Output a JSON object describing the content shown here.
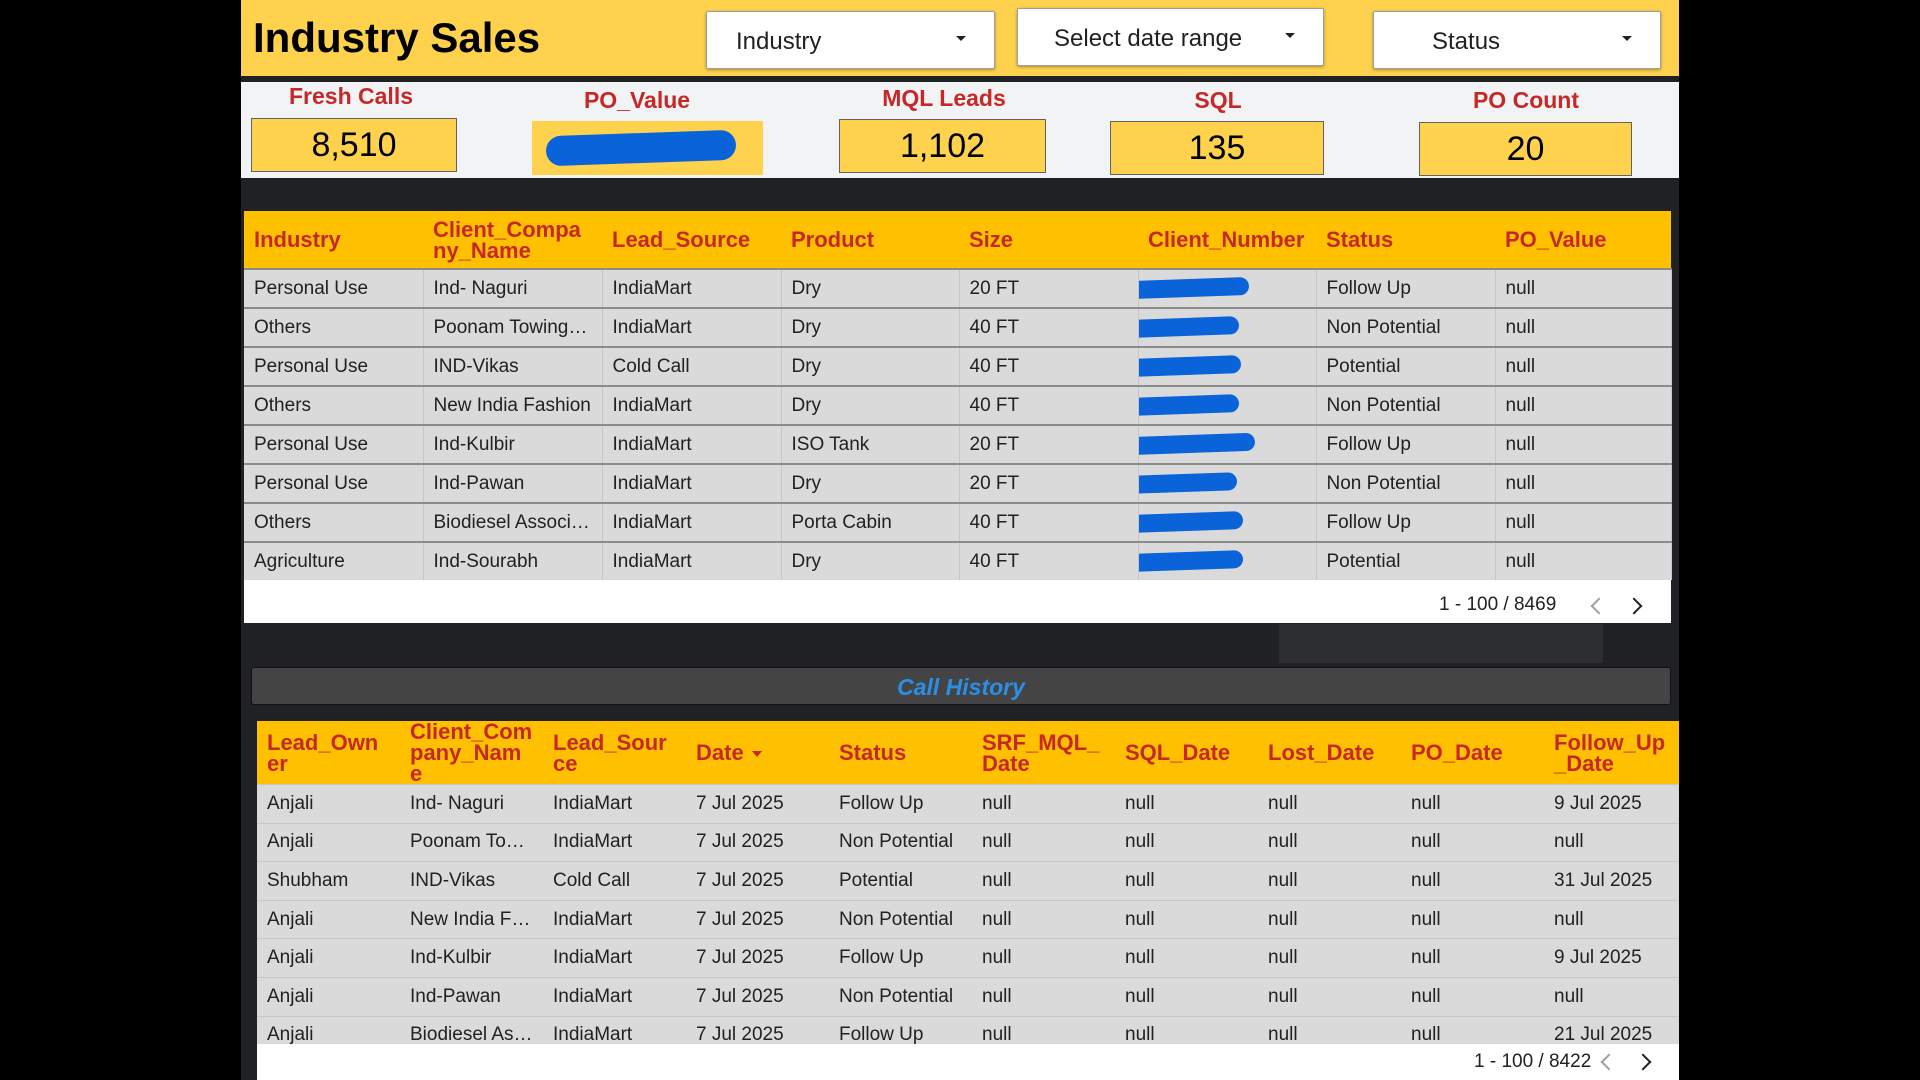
{
  "header": {
    "title": "Industry Sales",
    "filters": [
      {
        "label": "Industry"
      },
      {
        "label": "Select date range"
      },
      {
        "label": "Status"
      }
    ]
  },
  "kpis": [
    {
      "title": "Fresh Calls",
      "value": "8,510"
    },
    {
      "title": "PO_Value",
      "value": ""
    },
    {
      "title": "MQL Leads",
      "value": "1,102"
    },
    {
      "title": "SQL",
      "value": "135"
    },
    {
      "title": "PO Count",
      "value": "20"
    }
  ],
  "colors": {
    "header_bg": "#FFD24D",
    "table_header_bg": "#FFC000",
    "header_text": "#C62828",
    "redaction": "#0A63D8",
    "call_history_title": "#2B8FE8"
  },
  "leads_table": {
    "columns": [
      "Industry",
      "Client_Company_Name",
      "Lead_Source",
      "Product",
      "Size",
      "Client_Number",
      "Status",
      "PO_Value"
    ],
    "rows": [
      [
        "Personal Use",
        "Ind- Naguri",
        "IndiaMart",
        "Dry",
        "20 FT",
        "",
        "Follow Up",
        "null"
      ],
      [
        "Others",
        "Poonam Towing Service",
        "IndiaMart",
        "Dry",
        "40 FT",
        "",
        "Non Potential",
        "null"
      ],
      [
        "Personal Use",
        "IND-Vikas",
        "Cold Call",
        "Dry",
        "40 FT",
        "",
        "Potential",
        "null"
      ],
      [
        "Others",
        "New India Fashion",
        "IndiaMart",
        "Dry",
        "40 FT",
        "",
        "Non Potential",
        "null"
      ],
      [
        "Personal Use",
        "Ind-Kulbir",
        "IndiaMart",
        "ISO Tank",
        "20 FT",
        "",
        "Follow Up",
        "null"
      ],
      [
        "Personal Use",
        "Ind-Pawan",
        "IndiaMart",
        "Dry",
        "20 FT",
        "",
        "Non Potential",
        "null"
      ],
      [
        "Others",
        "Biodiesel Association",
        "IndiaMart",
        "Porta Cabin",
        "40 FT",
        "",
        "Follow Up",
        "null"
      ],
      [
        "Agriculture",
        "Ind-Sourabh",
        "IndiaMart",
        "Dry",
        "40 FT",
        "",
        "Potential",
        "null"
      ]
    ],
    "pagination": "1 - 100 / 8469"
  },
  "call_history": {
    "title": "Call History",
    "columns": [
      "Lead_Owner",
      "Client_Company_Name",
      "Lead_Source",
      "Date",
      "Status",
      "SRF_MQL_Date",
      "SQL_Date",
      "Lost_Date",
      "PO_Date",
      "Follow_Up_Date"
    ],
    "rows": [
      [
        "Anjali",
        "Ind- Naguri",
        "IndiaMart",
        "7 Jul 2025",
        "Follow Up",
        "null",
        "null",
        "null",
        "null",
        "9 Jul 2025"
      ],
      [
        "Anjali",
        "Poonam Towing Service",
        "IndiaMart",
        "7 Jul 2025",
        "Non Potential",
        "null",
        "null",
        "null",
        "null",
        "null"
      ],
      [
        "Shubham",
        "IND-Vikas",
        "Cold Call",
        "7 Jul 2025",
        "Potential",
        "null",
        "null",
        "null",
        "null",
        "31 Jul 2025"
      ],
      [
        "Anjali",
        "New India Fashion",
        "IndiaMart",
        "7 Jul 2025",
        "Non Potential",
        "null",
        "null",
        "null",
        "null",
        "null"
      ],
      [
        "Anjali",
        "Ind-Kulbir",
        "IndiaMart",
        "7 Jul 2025",
        "Follow Up",
        "null",
        "null",
        "null",
        "null",
        "9 Jul 2025"
      ],
      [
        "Anjali",
        "Ind-Pawan",
        "IndiaMart",
        "7 Jul 2025",
        "Non Potential",
        "null",
        "null",
        "null",
        "null",
        "null"
      ],
      [
        "Anjali",
        "Biodiesel Association",
        "IndiaMart",
        "7 Jul 2025",
        "Follow Up",
        "null",
        "null",
        "null",
        "null",
        "21 Jul 2025"
      ]
    ],
    "pagination": "1 - 100 / 8422"
  }
}
